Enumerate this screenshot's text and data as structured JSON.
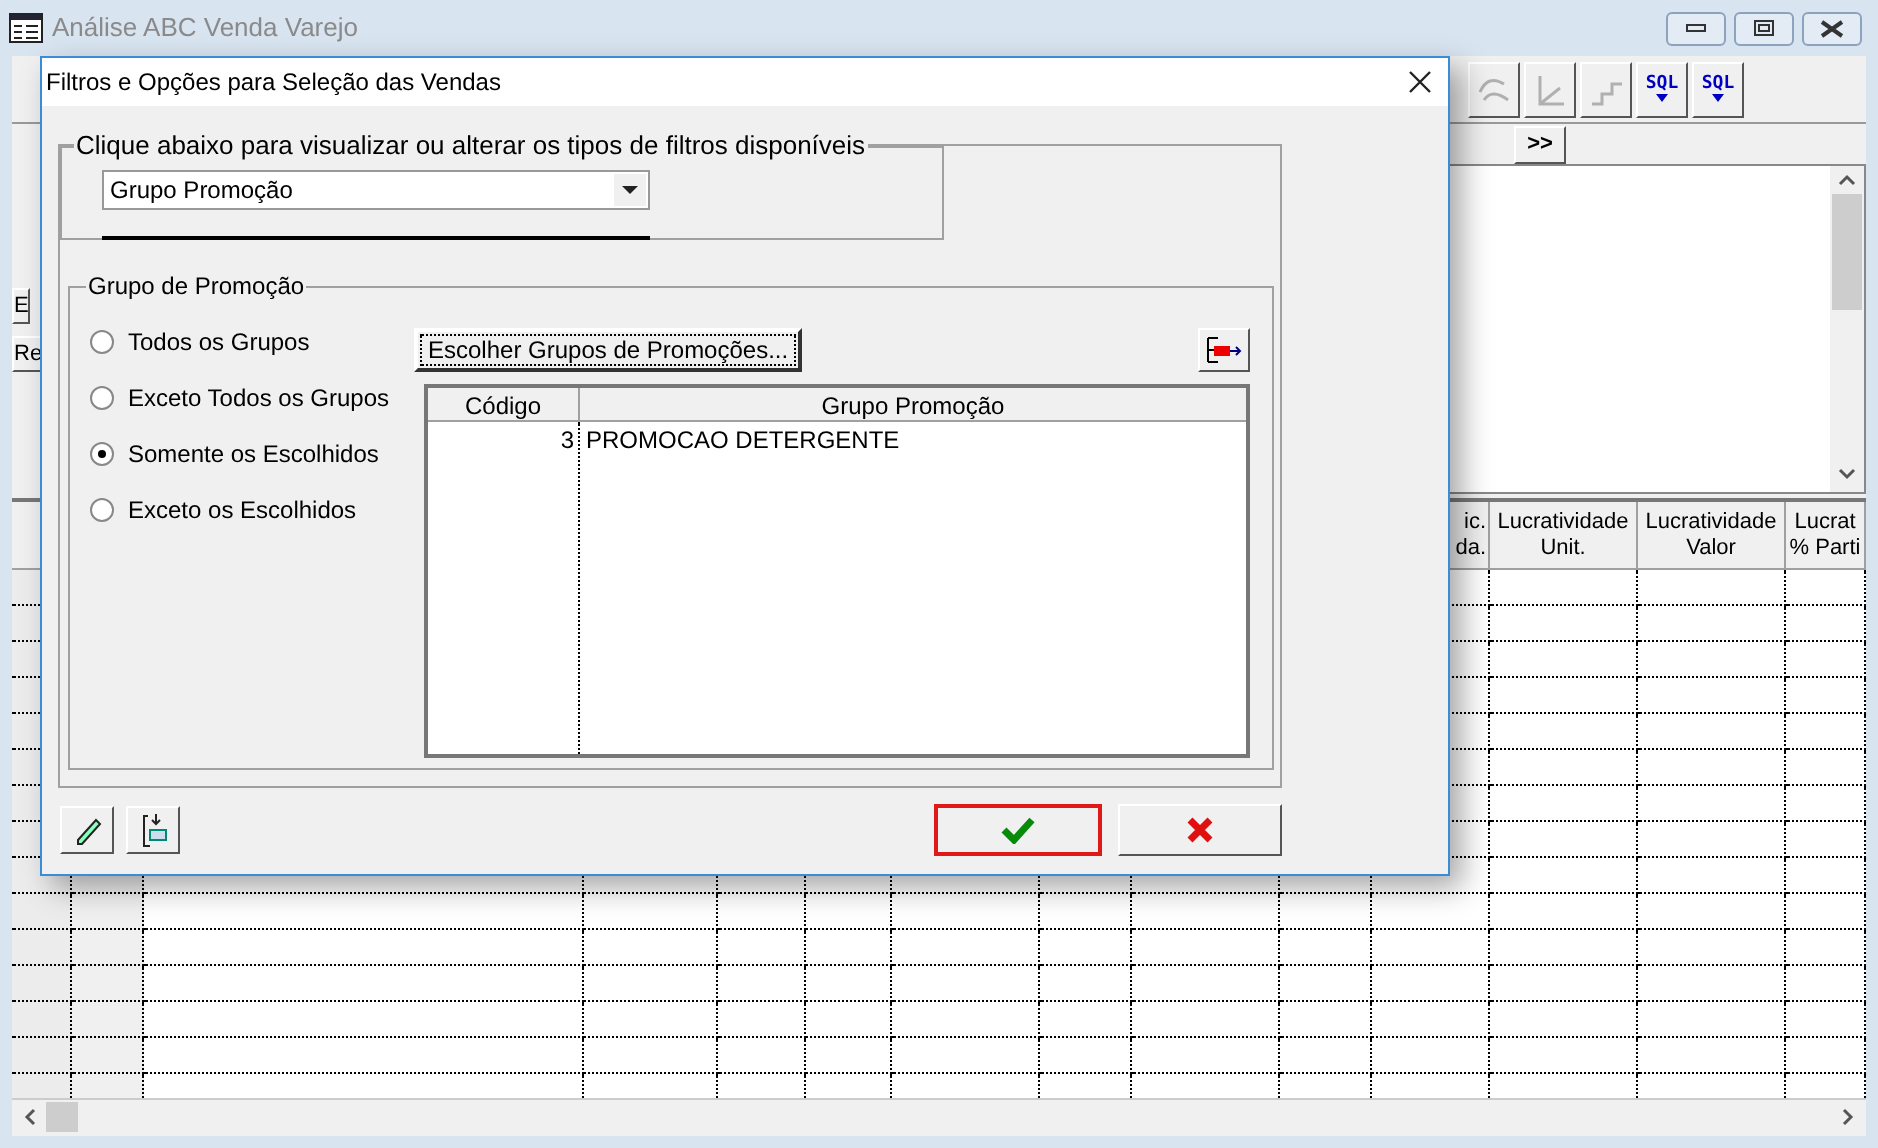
{
  "window": {
    "title": "Análise ABC Venda Varejo"
  },
  "toolbar": [
    {
      "kind": "curve"
    },
    {
      "kind": "angle"
    },
    {
      "kind": "steps"
    },
    {
      "kind": "sql",
      "label": "SQL"
    },
    {
      "kind": "sql",
      "label": "SQL"
    }
  ],
  "nav_button": ">>",
  "side_buttons": [
    "E",
    "Re"
  ],
  "grid": {
    "headers": [
      {
        "lines": [
          "ic.",
          "da."
        ]
      },
      {
        "lines": [
          "Lucratividade",
          "Unit."
        ]
      },
      {
        "lines": [
          "Lucratividade",
          "Valor"
        ]
      },
      {
        "lines": [
          "Lucrat",
          "% Parti"
        ]
      }
    ]
  },
  "dialog": {
    "title": "Filtros e Opções para Seleção das Vendas",
    "filter_group": {
      "legend": "Clique abaixo para visualizar ou alterar os tipos de filtros disponíveis",
      "select": {
        "value": "Grupo Promoção"
      }
    },
    "promo_group": {
      "legend": "Grupo de Promoção",
      "options": [
        {
          "label": "Todos os Grupos",
          "selected": false
        },
        {
          "label": "Exceto Todos os Grupos",
          "selected": false
        },
        {
          "label": "Somente os Escolhidos",
          "selected": true
        },
        {
          "label": "Exceto os Escolhidos",
          "selected": false
        }
      ],
      "choose_button": "Escolher Grupos de Promoções...",
      "table": {
        "columns": [
          "Código",
          "Grupo Promoção"
        ],
        "rows": [
          [
            "3",
            "PROMOCAO DETERGENTE"
          ]
        ]
      }
    },
    "buttons": [
      {
        "kind": "ok",
        "focused": true
      },
      {
        "kind": "cancel",
        "focused": false
      }
    ]
  }
}
